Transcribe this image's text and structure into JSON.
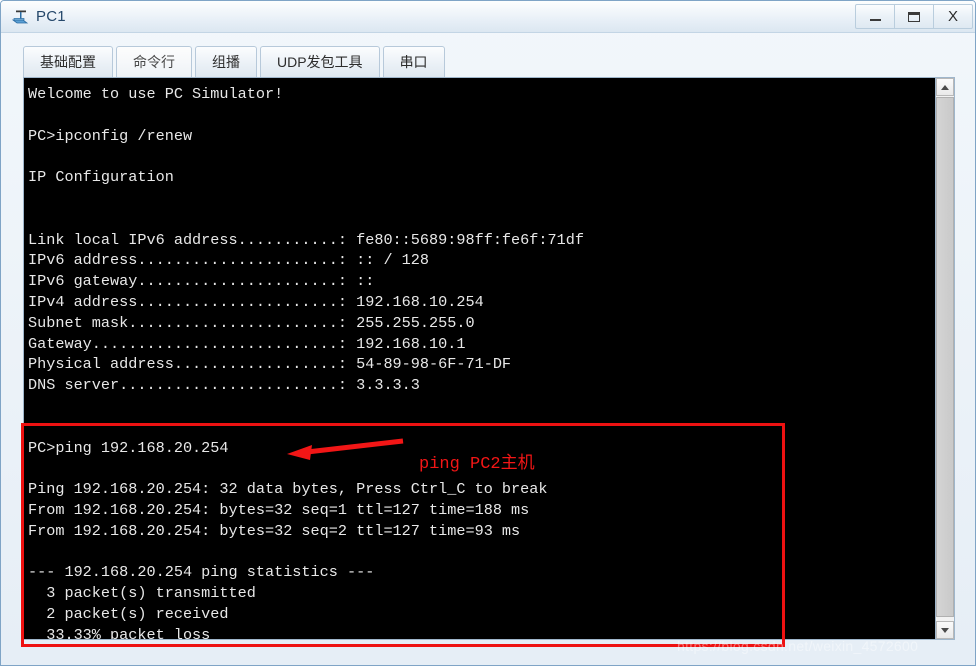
{
  "window": {
    "title": "PC1",
    "icon": "pc-device-icon",
    "controls": {
      "minimize": "–",
      "maximize": "□",
      "close": "X"
    }
  },
  "tabs": [
    {
      "label": "基础配置",
      "active": true
    },
    {
      "label": "命令行",
      "active": false
    },
    {
      "label": "组播",
      "active": false
    },
    {
      "label": "UDP发包工具",
      "active": false
    },
    {
      "label": "串口",
      "active": false
    }
  ],
  "console": {
    "lines": [
      "Welcome to use PC Simulator!",
      "",
      "PC>ipconfig /renew",
      "",
      "IP Configuration",
      "",
      "",
      "Link local IPv6 address...........: fe80::5689:98ff:fe6f:71df",
      "IPv6 address......................: :: / 128",
      "IPv6 gateway......................: ::",
      "IPv4 address......................: 192.168.10.254",
      "Subnet mask.......................: 255.255.255.0",
      "Gateway...........................: 192.168.10.1",
      "Physical address..................: 54-89-98-6F-71-DF",
      "DNS server........................: 3.3.3.3",
      "",
      "",
      "PC>ping 192.168.20.254",
      "",
      "Ping 192.168.20.254: 32 data bytes, Press Ctrl_C to break",
      "From 192.168.20.254: bytes=32 seq=1 ttl=127 time=188 ms",
      "From 192.168.20.254: bytes=32 seq=2 ttl=127 time=93 ms",
      "",
      "--- 192.168.20.254 ping statistics ---",
      "  3 packet(s) transmitted",
      "  2 packet(s) received",
      "  33.33% packet loss"
    ]
  },
  "annotation": {
    "text": "ping PC2主机",
    "color": "#f21616",
    "arrow": "left-arrow-icon"
  },
  "scrollbar": {
    "up": "chevron-up-icon",
    "down": "chevron-down-icon"
  },
  "watermark": {
    "text": "https://blog.csdn.net/weixin_4572600"
  }
}
